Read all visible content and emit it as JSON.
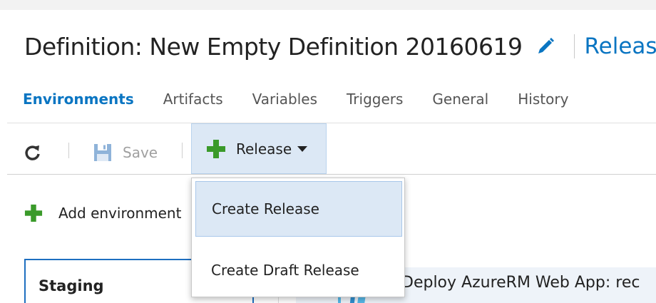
{
  "header": {
    "title": "Definition: New Empty Definition 20160619",
    "releases_link": "Releases"
  },
  "tabs": [
    {
      "label": "Environments",
      "active": true
    },
    {
      "label": "Artifacts",
      "active": false
    },
    {
      "label": "Variables",
      "active": false
    },
    {
      "label": "Triggers",
      "active": false
    },
    {
      "label": "General",
      "active": false
    },
    {
      "label": "History",
      "active": false
    }
  ],
  "toolbar": {
    "save_label": "Save",
    "release_label": "Release"
  },
  "release_menu": {
    "items": [
      "Create Release",
      "Create Draft Release"
    ]
  },
  "environments": {
    "add_label": "Add environment",
    "cards": [
      {
        "name": "Staging"
      }
    ]
  },
  "task": {
    "label": "Deploy AzureRM Web App: rec"
  },
  "colors": {
    "accent": "#0a75c2",
    "selection_bg": "#dce8f5",
    "add_green": "#3a9a2a"
  }
}
